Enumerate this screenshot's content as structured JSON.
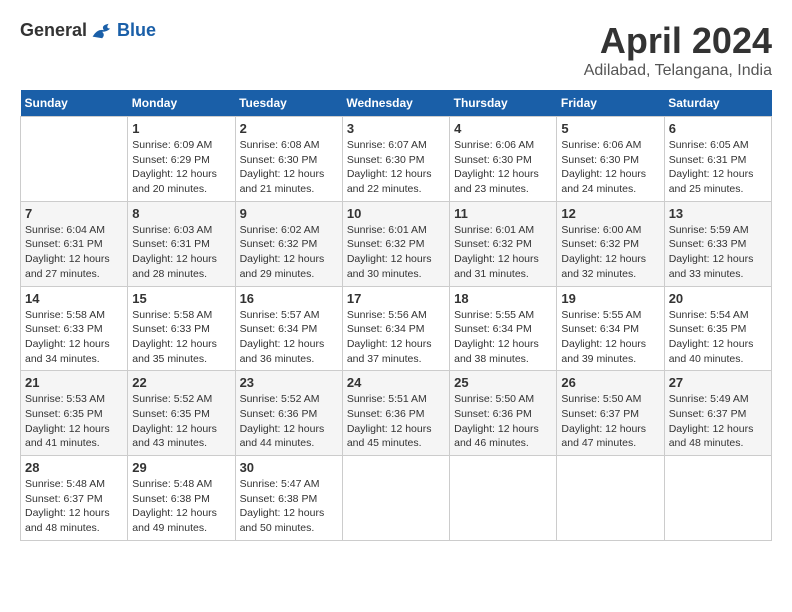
{
  "header": {
    "logo_general": "General",
    "logo_blue": "Blue",
    "title": "April 2024",
    "location": "Adilabad, Telangana, India"
  },
  "weekdays": [
    "Sunday",
    "Monday",
    "Tuesday",
    "Wednesday",
    "Thursday",
    "Friday",
    "Saturday"
  ],
  "weeks": [
    [
      {
        "day": "",
        "sunrise": "",
        "sunset": "",
        "daylight": ""
      },
      {
        "day": "1",
        "sunrise": "Sunrise: 6:09 AM",
        "sunset": "Sunset: 6:29 PM",
        "daylight": "Daylight: 12 hours and 20 minutes."
      },
      {
        "day": "2",
        "sunrise": "Sunrise: 6:08 AM",
        "sunset": "Sunset: 6:30 PM",
        "daylight": "Daylight: 12 hours and 21 minutes."
      },
      {
        "day": "3",
        "sunrise": "Sunrise: 6:07 AM",
        "sunset": "Sunset: 6:30 PM",
        "daylight": "Daylight: 12 hours and 22 minutes."
      },
      {
        "day": "4",
        "sunrise": "Sunrise: 6:06 AM",
        "sunset": "Sunset: 6:30 PM",
        "daylight": "Daylight: 12 hours and 23 minutes."
      },
      {
        "day": "5",
        "sunrise": "Sunrise: 6:06 AM",
        "sunset": "Sunset: 6:30 PM",
        "daylight": "Daylight: 12 hours and 24 minutes."
      },
      {
        "day": "6",
        "sunrise": "Sunrise: 6:05 AM",
        "sunset": "Sunset: 6:31 PM",
        "daylight": "Daylight: 12 hours and 25 minutes."
      }
    ],
    [
      {
        "day": "7",
        "sunrise": "Sunrise: 6:04 AM",
        "sunset": "Sunset: 6:31 PM",
        "daylight": "Daylight: 12 hours and 27 minutes."
      },
      {
        "day": "8",
        "sunrise": "Sunrise: 6:03 AM",
        "sunset": "Sunset: 6:31 PM",
        "daylight": "Daylight: 12 hours and 28 minutes."
      },
      {
        "day": "9",
        "sunrise": "Sunrise: 6:02 AM",
        "sunset": "Sunset: 6:32 PM",
        "daylight": "Daylight: 12 hours and 29 minutes."
      },
      {
        "day": "10",
        "sunrise": "Sunrise: 6:01 AM",
        "sunset": "Sunset: 6:32 PM",
        "daylight": "Daylight: 12 hours and 30 minutes."
      },
      {
        "day": "11",
        "sunrise": "Sunrise: 6:01 AM",
        "sunset": "Sunset: 6:32 PM",
        "daylight": "Daylight: 12 hours and 31 minutes."
      },
      {
        "day": "12",
        "sunrise": "Sunrise: 6:00 AM",
        "sunset": "Sunset: 6:32 PM",
        "daylight": "Daylight: 12 hours and 32 minutes."
      },
      {
        "day": "13",
        "sunrise": "Sunrise: 5:59 AM",
        "sunset": "Sunset: 6:33 PM",
        "daylight": "Daylight: 12 hours and 33 minutes."
      }
    ],
    [
      {
        "day": "14",
        "sunrise": "Sunrise: 5:58 AM",
        "sunset": "Sunset: 6:33 PM",
        "daylight": "Daylight: 12 hours and 34 minutes."
      },
      {
        "day": "15",
        "sunrise": "Sunrise: 5:58 AM",
        "sunset": "Sunset: 6:33 PM",
        "daylight": "Daylight: 12 hours and 35 minutes."
      },
      {
        "day": "16",
        "sunrise": "Sunrise: 5:57 AM",
        "sunset": "Sunset: 6:34 PM",
        "daylight": "Daylight: 12 hours and 36 minutes."
      },
      {
        "day": "17",
        "sunrise": "Sunrise: 5:56 AM",
        "sunset": "Sunset: 6:34 PM",
        "daylight": "Daylight: 12 hours and 37 minutes."
      },
      {
        "day": "18",
        "sunrise": "Sunrise: 5:55 AM",
        "sunset": "Sunset: 6:34 PM",
        "daylight": "Daylight: 12 hours and 38 minutes."
      },
      {
        "day": "19",
        "sunrise": "Sunrise: 5:55 AM",
        "sunset": "Sunset: 6:34 PM",
        "daylight": "Daylight: 12 hours and 39 minutes."
      },
      {
        "day": "20",
        "sunrise": "Sunrise: 5:54 AM",
        "sunset": "Sunset: 6:35 PM",
        "daylight": "Daylight: 12 hours and 40 minutes."
      }
    ],
    [
      {
        "day": "21",
        "sunrise": "Sunrise: 5:53 AM",
        "sunset": "Sunset: 6:35 PM",
        "daylight": "Daylight: 12 hours and 41 minutes."
      },
      {
        "day": "22",
        "sunrise": "Sunrise: 5:52 AM",
        "sunset": "Sunset: 6:35 PM",
        "daylight": "Daylight: 12 hours and 43 minutes."
      },
      {
        "day": "23",
        "sunrise": "Sunrise: 5:52 AM",
        "sunset": "Sunset: 6:36 PM",
        "daylight": "Daylight: 12 hours and 44 minutes."
      },
      {
        "day": "24",
        "sunrise": "Sunrise: 5:51 AM",
        "sunset": "Sunset: 6:36 PM",
        "daylight": "Daylight: 12 hours and 45 minutes."
      },
      {
        "day": "25",
        "sunrise": "Sunrise: 5:50 AM",
        "sunset": "Sunset: 6:36 PM",
        "daylight": "Daylight: 12 hours and 46 minutes."
      },
      {
        "day": "26",
        "sunrise": "Sunrise: 5:50 AM",
        "sunset": "Sunset: 6:37 PM",
        "daylight": "Daylight: 12 hours and 47 minutes."
      },
      {
        "day": "27",
        "sunrise": "Sunrise: 5:49 AM",
        "sunset": "Sunset: 6:37 PM",
        "daylight": "Daylight: 12 hours and 48 minutes."
      }
    ],
    [
      {
        "day": "28",
        "sunrise": "Sunrise: 5:48 AM",
        "sunset": "Sunset: 6:37 PM",
        "daylight": "Daylight: 12 hours and 48 minutes."
      },
      {
        "day": "29",
        "sunrise": "Sunrise: 5:48 AM",
        "sunset": "Sunset: 6:38 PM",
        "daylight": "Daylight: 12 hours and 49 minutes."
      },
      {
        "day": "30",
        "sunrise": "Sunrise: 5:47 AM",
        "sunset": "Sunset: 6:38 PM",
        "daylight": "Daylight: 12 hours and 50 minutes."
      },
      {
        "day": "",
        "sunrise": "",
        "sunset": "",
        "daylight": ""
      },
      {
        "day": "",
        "sunrise": "",
        "sunset": "",
        "daylight": ""
      },
      {
        "day": "",
        "sunrise": "",
        "sunset": "",
        "daylight": ""
      },
      {
        "day": "",
        "sunrise": "",
        "sunset": "",
        "daylight": ""
      }
    ]
  ]
}
